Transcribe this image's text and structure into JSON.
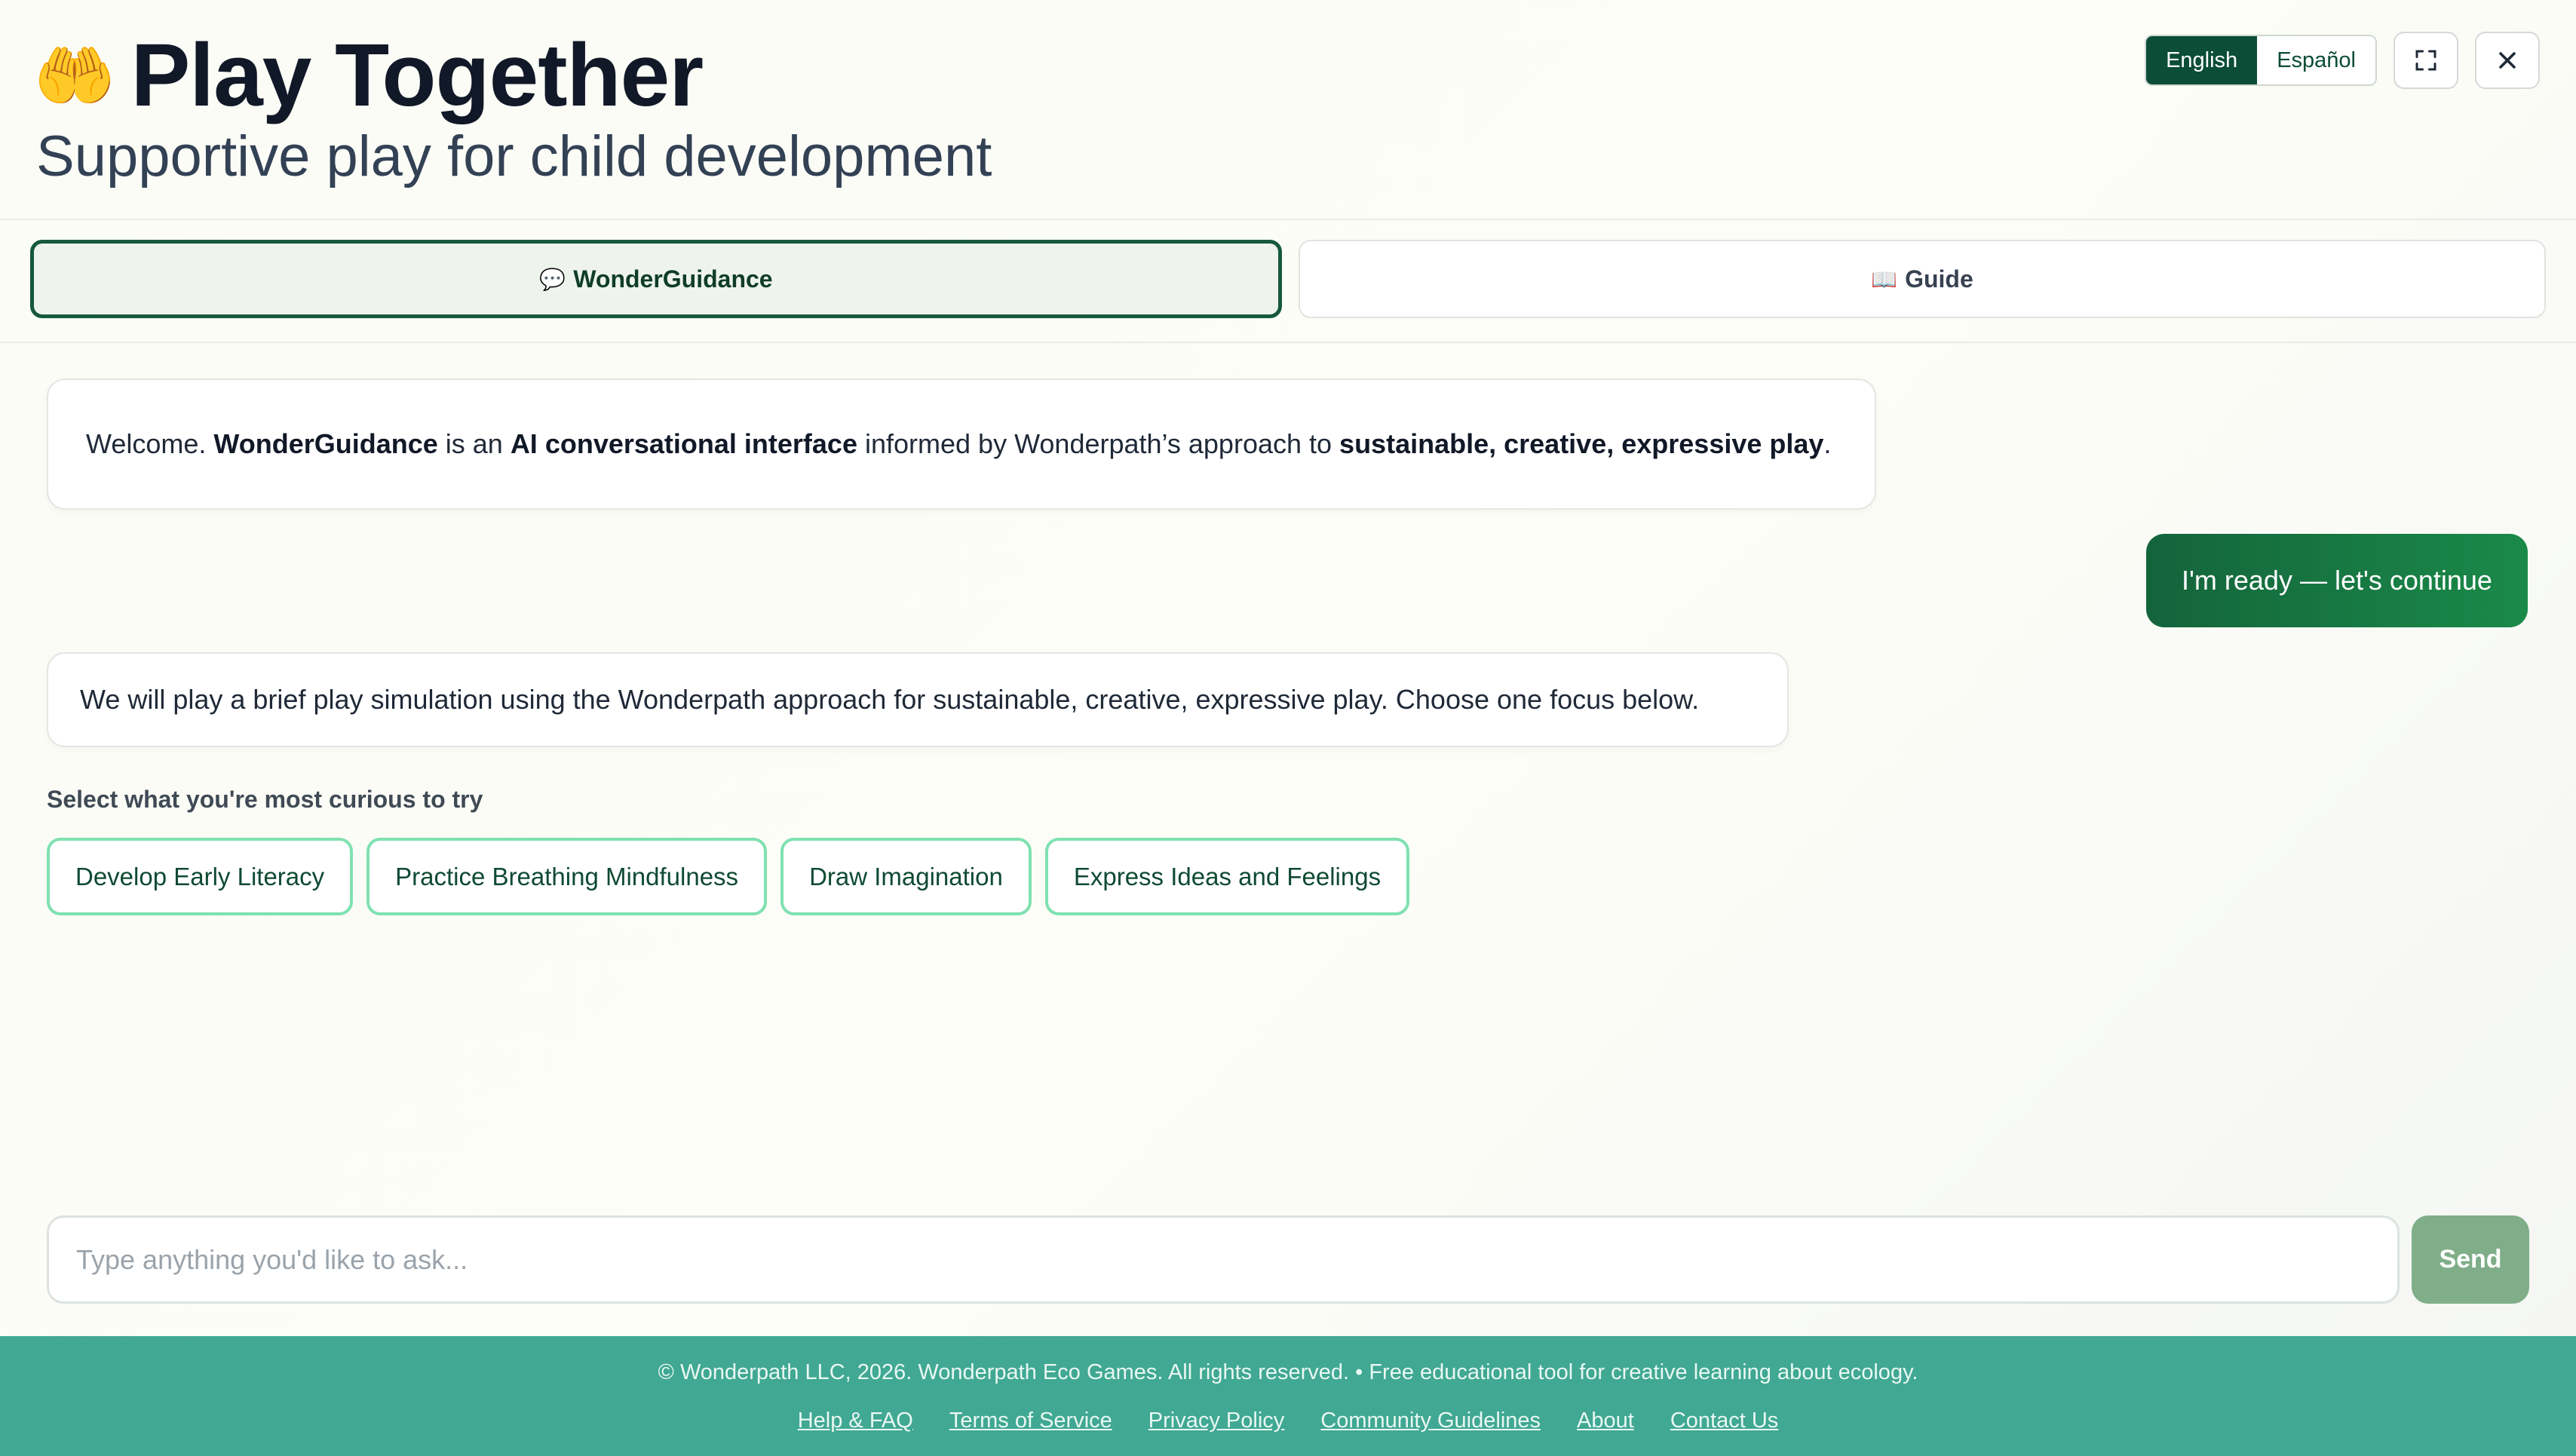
{
  "header": {
    "emoji": "🤲",
    "title": "Play Together",
    "subtitle": "Supportive play for child development",
    "languages": [
      {
        "label": "English",
        "active": true
      },
      {
        "label": "Español",
        "active": false
      }
    ],
    "fullscreen_icon": "fullscreen-icon",
    "close_icon": "close-icon"
  },
  "tabs": [
    {
      "icon": "💬",
      "label": "WonderGuidance",
      "active": true
    },
    {
      "icon": "📖",
      "label": "Guide",
      "active": false
    }
  ],
  "chat": {
    "welcome": {
      "t1": "Welcome. ",
      "b1": "WonderGuidance",
      "t2": " is an ",
      "b2": "AI conversational interface",
      "t3": " informed by Wonderpath’s approach to ",
      "b3": "sustainable, creative, expressive play",
      "t4": "."
    },
    "user_reply": "I'm ready — let's continue",
    "simulation_text": "We will play a brief play simulation using the Wonderpath approach for sustainable, creative, expressive play. Choose one focus below.",
    "select_label": "Select what you're most curious to try",
    "options": [
      "Develop Early Literacy",
      "Practice Breathing Mindfulness",
      "Draw Imagination",
      "Express Ideas and Feelings"
    ]
  },
  "input": {
    "placeholder": "Type anything you'd like to ask...",
    "value": "",
    "send_label": "Send"
  },
  "footer": {
    "copyright": "© Wonderpath LLC, 2026. Wonderpath Eco Games. All rights reserved. • Free educational tool for creative learning about ecology.",
    "links": [
      "Help & FAQ",
      "Terms of Service",
      "Privacy Policy",
      "Community Guidelines",
      "About",
      "Contact Us"
    ]
  },
  "colors": {
    "brand_dark": "#0b4d36",
    "accent_green": "#1a8a49",
    "option_border": "#7fe1b1",
    "send_button": "#7fae88",
    "footer_bg": "#40a893"
  }
}
